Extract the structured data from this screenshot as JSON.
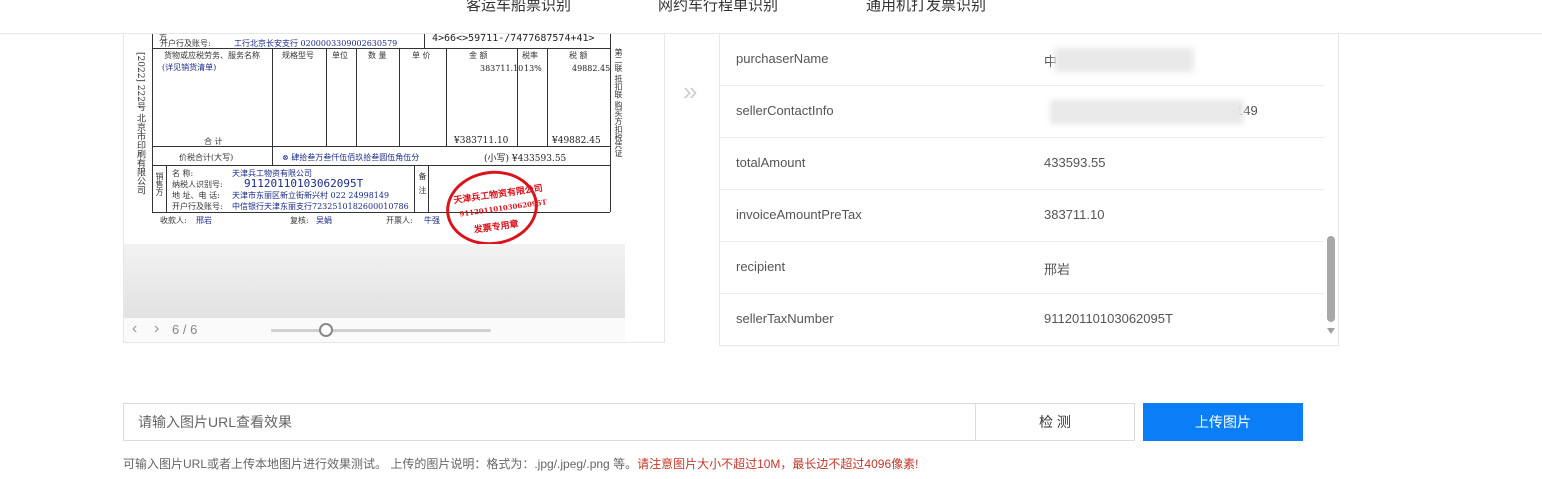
{
  "top_tabs": [
    "客运车船票识别",
    "网约车行程单识别",
    "通用机打发票识别"
  ],
  "invoice": {
    "bank_line_label": "开户行及账号:",
    "bank_line_value": "工行北京长安支行 0200003309002630579",
    "cipher": "4>66<>59711-/7477687574+41>",
    "col_headers": [
      "货物或应税劳务、服务名称",
      "规格型号",
      "单位",
      "数 量",
      "单 价",
      "金 额",
      "税率",
      "税 额"
    ],
    "item_name": "(详见销货清单)",
    "amount": "383711.10",
    "tax_rate": "13%",
    "tax": "49882.45",
    "total_label": "合   计",
    "total_amount": "¥383711.10",
    "total_tax": "¥49882.45",
    "price_tax_label": "价税合计(大写)",
    "price_tax_cn": "⊗ 肆拾叁万叁仟伍佰玖拾叁圆伍角伍分",
    "price_tax_small": "(小写) ¥433593.55",
    "seller_name_label": "名    称:",
    "seller_name": "天津兵工物资有限公司",
    "seller_tax_label": "纳税人识别号:",
    "seller_tax": "91120110103062095T",
    "seller_addr_label": "地 址、电 话:",
    "seller_addr": "天津市东丽区新立街新兴村 022  24998149",
    "seller_bank_label": "开户行及账号:",
    "seller_bank": "中信银行天津东丽支行7232510182600010786",
    "seller_side": "销售方",
    "remark": "备注",
    "payee_label": "收款人:",
    "payee": "邢岩",
    "reviewer_label": "复核:",
    "reviewer": "吴娟",
    "issuer_label": "开票人:",
    "issuer": "牛强",
    "seal_top": "天津兵工物资有限公司",
    "seal_mid": "91120110103062095T",
    "seal_bottom": "发票专用章",
    "left_margin": "[2022] 222号 北京市印刷有限公司",
    "right_margin": "第二联 抵扣联 购买方扣税凭证",
    "top_left_char": "方"
  },
  "pager": {
    "count": "6 / 6",
    "prev_icon": "chevron-left-icon",
    "next_icon": "chevron-right-icon",
    "zoom_fraction": 0.25
  },
  "results": {
    "rows": [
      {
        "key": "purchaserName",
        "value": "中"
      },
      {
        "key": "sellerContactInfo",
        "value": "149"
      },
      {
        "key": "totalAmount",
        "value": "433593.55"
      },
      {
        "key": "invoiceAmountPreTax",
        "value": "383711.10"
      },
      {
        "key": "recipient",
        "value": "邢岩"
      },
      {
        "key": "sellerTaxNumber",
        "value": "91120110103062095T"
      }
    ]
  },
  "url_bar": {
    "placeholder": "请输入图片URL查看效果",
    "detect_label": "检 测",
    "upload_label": "上传图片"
  },
  "hint": {
    "text": "可输入图片URL或者上传本地图片进行效果测试。 上传的图片说明：格式为：.jpg/.jpeg/.png 等。",
    "warning": "请注意图片大小不超过10M，最长边不超过4096像素!"
  },
  "colors": {
    "primary": "#0a7ef7",
    "warning": "#c0392b",
    "seal": "#d9141d"
  }
}
